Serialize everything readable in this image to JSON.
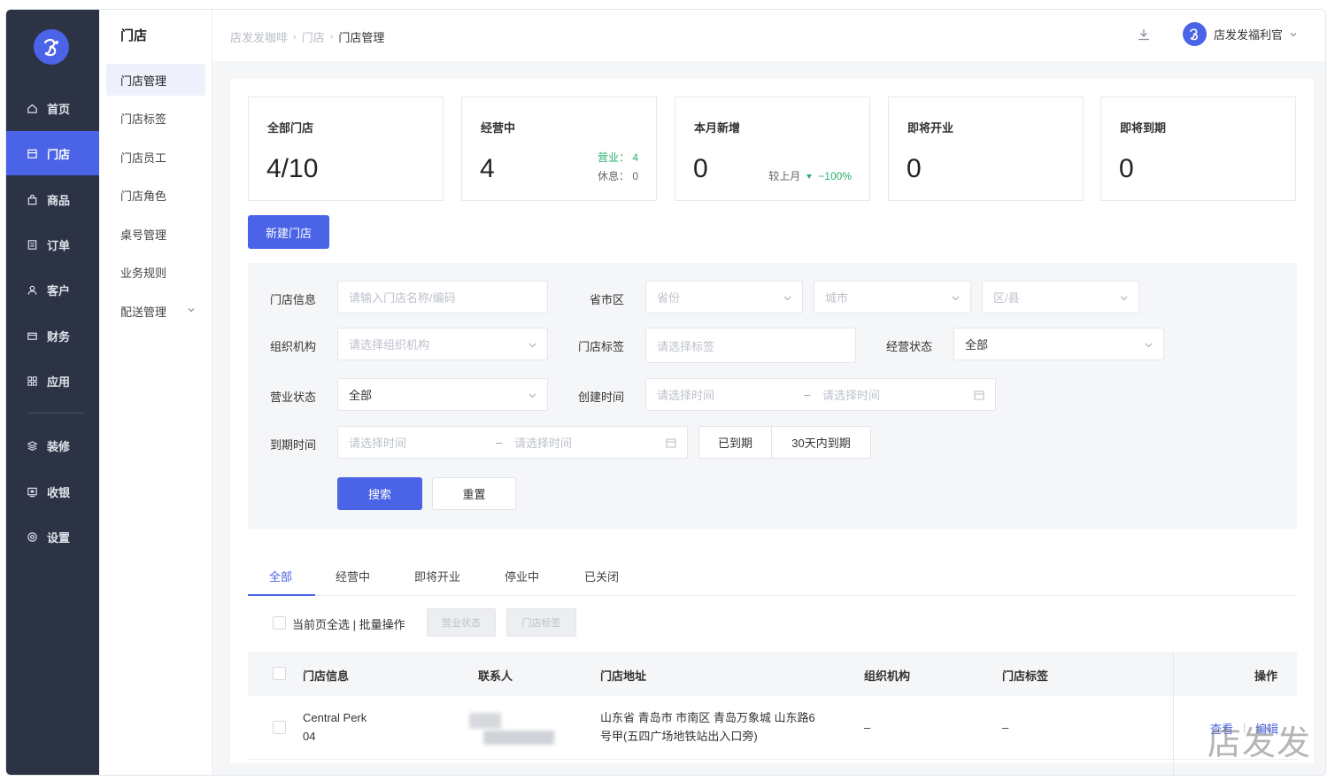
{
  "sidebar": {
    "items": [
      {
        "label": "首页",
        "icon": "home-icon"
      },
      {
        "label": "门店",
        "icon": "store-icon",
        "active": true
      },
      {
        "label": "商品",
        "icon": "bag-icon"
      },
      {
        "label": "订单",
        "icon": "order-icon"
      },
      {
        "label": "客户",
        "icon": "user-icon"
      },
      {
        "label": "财务",
        "icon": "wallet-icon"
      },
      {
        "label": "应用",
        "icon": "apps-icon"
      },
      {
        "label": "装修",
        "icon": "layers-icon"
      },
      {
        "label": "收银",
        "icon": "cashier-icon"
      },
      {
        "label": "设置",
        "icon": "gear-icon"
      }
    ]
  },
  "subnav": {
    "title": "门店",
    "items": [
      {
        "label": "门店管理"
      },
      {
        "label": "门店标签"
      },
      {
        "label": "门店员工"
      },
      {
        "label": "门店角色"
      },
      {
        "label": "桌号管理"
      },
      {
        "label": "业务规则"
      },
      {
        "label": "配送管理"
      }
    ]
  },
  "header": {
    "breadcrumb": [
      "店发发咖啡",
      "门店",
      "门店管理"
    ],
    "user_name": "店发发福利官"
  },
  "stats": {
    "all": {
      "label": "全部门店",
      "value": "4/10"
    },
    "operating": {
      "label": "经营中",
      "value": "4",
      "open_label": "营业：",
      "open_value": "4",
      "rest_label": "休息：",
      "rest_value": "0"
    },
    "new": {
      "label": "本月新增",
      "value": "0",
      "compare_label": "较上月",
      "compare_value": "−100%"
    },
    "opening": {
      "label": "即将开业",
      "value": "0"
    },
    "expiring": {
      "label": "即将到期",
      "value": "0"
    }
  },
  "actions": {
    "new_store": "新建门店"
  },
  "filter": {
    "store_info": {
      "label": "门店信息",
      "placeholder": "请输入门店名称/编码"
    },
    "region": {
      "label": "省市区",
      "province": "省份",
      "city": "城市",
      "district": "区/县"
    },
    "org": {
      "label": "组织机构",
      "placeholder": "请选择组织机构"
    },
    "tags": {
      "label": "门店标签",
      "placeholder": "请选择标签"
    },
    "biz_status": {
      "label": "经营状态",
      "value": "全部"
    },
    "open_status": {
      "label": "营业状态",
      "value": "全部"
    },
    "created": {
      "label": "创建时间",
      "start": "请选择时间",
      "sep": "–",
      "end": "请选择时间"
    },
    "expire": {
      "label": "到期时间",
      "start": "请选择时间",
      "sep": "–",
      "end": "请选择时间",
      "expired": "已到期",
      "within30": "30天内到期"
    },
    "search": "搜索",
    "reset": "重置"
  },
  "tabs": [
    {
      "label": "全部",
      "active": true
    },
    {
      "label": "经营中"
    },
    {
      "label": "即将开业"
    },
    {
      "label": "停业中"
    },
    {
      "label": "已关闭"
    }
  ],
  "bulk": {
    "label": "当前页全选 | 批量操作",
    "btn_status": "营业状态",
    "btn_tag": "门店标签"
  },
  "table": {
    "columns": [
      "门店信息",
      "联系人",
      "门店地址",
      "组织机构",
      "门店标签",
      "操作"
    ],
    "rows": [
      {
        "name": "Central Perk",
        "code": "04",
        "address_line1": "山东省 青岛市 市南区 青岛万象城 山东路6",
        "address_line2": "号甲(五四广场地铁站出入口旁)",
        "org": "–",
        "tag": "–",
        "view": "查看",
        "edit": "编辑"
      }
    ]
  },
  "watermark": "店发发",
  "colors": {
    "accent": "#4b63e6",
    "sidebar": "#2c3345",
    "success": "#25b06a"
  }
}
